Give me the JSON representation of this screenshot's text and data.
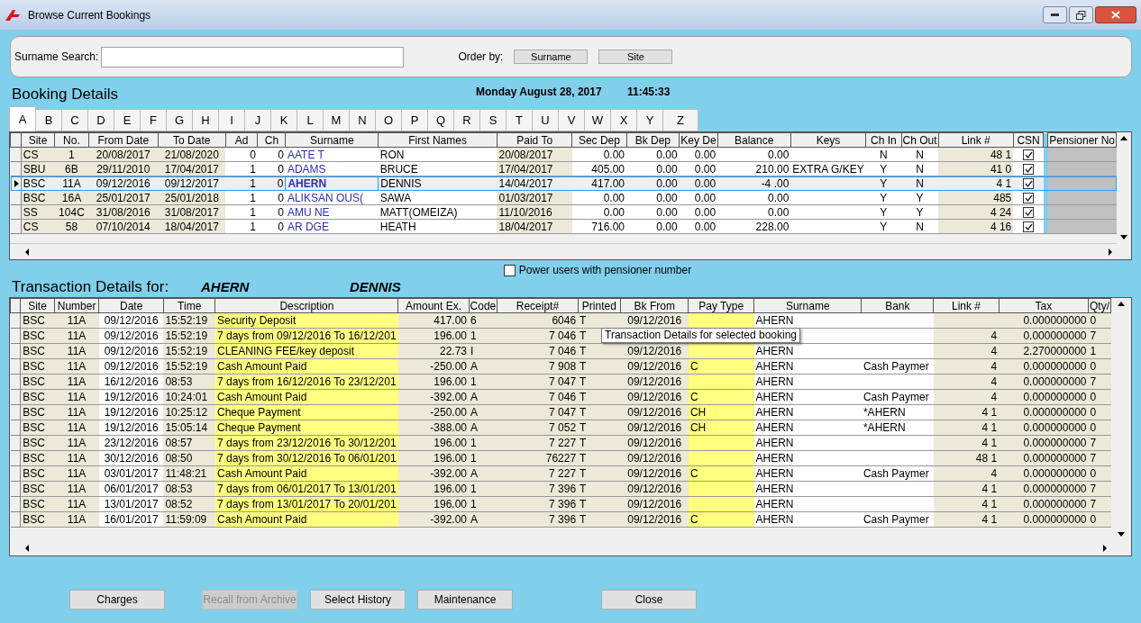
{
  "window": {
    "title": "Browse Current Bookings"
  },
  "search": {
    "label": "Surname Search:"
  },
  "order_by": {
    "label": "Order by:",
    "buttons": [
      "Surname",
      "Site"
    ]
  },
  "booking_heading": "Booking Details",
  "date": "Monday August 28, 2017",
  "time": "11:45:33",
  "tabs": [
    {
      "label": "A",
      "selected": true
    },
    {
      "label": "B",
      "selected": false
    },
    {
      "label": "C",
      "selected": false
    },
    {
      "label": "D",
      "selected": false
    },
    {
      "label": "E",
      "selected": false
    },
    {
      "label": "F",
      "selected": false
    },
    {
      "label": "G",
      "selected": false
    },
    {
      "label": "H",
      "selected": false
    },
    {
      "label": "I",
      "selected": false
    },
    {
      "label": "J",
      "selected": false
    },
    {
      "label": "K",
      "selected": false
    },
    {
      "label": "L",
      "selected": false
    },
    {
      "label": "M",
      "selected": false
    },
    {
      "label": "N",
      "selected": false
    },
    {
      "label": "O",
      "selected": false
    },
    {
      "label": "P",
      "selected": false
    },
    {
      "label": "Q",
      "selected": false
    },
    {
      "label": "R",
      "selected": false
    },
    {
      "label": "S",
      "selected": false
    },
    {
      "label": "T",
      "selected": false
    },
    {
      "label": "U",
      "selected": false
    },
    {
      "label": "V",
      "selected": false
    },
    {
      "label": "W",
      "selected": false
    },
    {
      "label": "X",
      "selected": false
    },
    {
      "label": "Y",
      "selected": false
    },
    {
      "label": "Z",
      "selected": false
    }
  ],
  "bookings": {
    "columns": [
      "Site",
      "No.",
      "From Date",
      "To Date",
      "Ad",
      "Ch",
      "Surname",
      "First Names",
      "Paid To",
      "Sec Dep",
      "Bk Dep",
      "Key De",
      "Balance",
      "Keys",
      "Ch In",
      "Ch Out",
      "Link #",
      "CSN",
      "Pensioner No"
    ],
    "rows": [
      {
        "selected": false,
        "csn": true,
        "cells": [
          "CS",
          "1",
          "20/08/2017",
          "21/08/2020",
          "0",
          "0",
          "AATE T",
          "RON",
          "20/08/2017",
          "0.00",
          "0.00",
          "0.00",
          "0.00",
          null,
          "N",
          "N",
          "48 1"
        ]
      },
      {
        "selected": false,
        "csn": true,
        "cells": [
          "SBU",
          "6B",
          "29/11/2010",
          "17/04/2017",
          "1",
          "0",
          "ADAMS",
          "BRUCE",
          "17/04/2017",
          "405.00",
          "0.00",
          "0.00",
          "210.00",
          "EXTRA G/KEY",
          "Y",
          "N",
          "41 0"
        ]
      },
      {
        "selected": true,
        "csn": true,
        "cells": [
          "BSC",
          "11A",
          "09/12/2016",
          "09/12/2017",
          "1",
          "0",
          "AHERN",
          "DENNIS",
          "14/04/2017",
          "417.00",
          "0.00",
          "0.00",
          "-4 .00",
          null,
          "Y",
          "N",
          "4 1"
        ]
      },
      {
        "selected": false,
        "csn": true,
        "cells": [
          "BSC",
          "16A",
          "25/01/2017",
          "25/01/2018",
          "1",
          "0",
          "ALIKSAN OUS(",
          "SAWA",
          "01/03/2017",
          "0.00",
          "0.00",
          "0.00",
          "0.00",
          null,
          "Y",
          "Y",
          "485"
        ]
      },
      {
        "selected": false,
        "csn": true,
        "cells": [
          "SS",
          "104C",
          "31/08/2016",
          "31/08/2017",
          "1",
          "0",
          "AMU NE",
          "MATT(OMEIZA)",
          "11/10/2016",
          "0.00",
          "0.00",
          "0.00",
          "0.00",
          null,
          "Y",
          "Y",
          "4 24"
        ]
      },
      {
        "selected": false,
        "csn": true,
        "cells": [
          "CS",
          "58",
          "07/10/2014",
          "18/04/2017",
          "1",
          "0",
          "AR DGE",
          "HEATH",
          "18/04/2017",
          "716.00",
          "0.00",
          "0.00",
          "228.00",
          null,
          "Y",
          "N",
          "4 16"
        ]
      }
    ]
  },
  "power_users": {
    "label": "Power users with pensioner number",
    "checked": false
  },
  "transactions_heading": {
    "label": "Transaction Details for:",
    "surname": "AHERN",
    "first_names": "DENNIS"
  },
  "transactions": {
    "columns": [
      "Site",
      "Number",
      "Date",
      "Time",
      "Description",
      "Amount Ex.",
      "Code",
      "Receipt#",
      "Printed",
      "Bk From",
      "Pay Type",
      "Surname",
      "Bank",
      "Link #",
      "Tax",
      "Qty/"
    ],
    "rows": [
      [
        "BSC",
        "11A",
        "09/12/2016",
        "15:52:19",
        "Security Deposit",
        "417.00",
        "6",
        "6046",
        "T",
        "09/12/2016",
        null,
        "AHERN",
        null,
        null,
        "0.000000000",
        "0"
      ],
      [
        "BSC",
        "11A",
        "09/12/2016",
        "15:52:19",
        "7 days from 09/12/2016 To 16/12/201",
        "196.00",
        "1",
        "7 046",
        "T",
        null,
        null,
        null,
        null,
        "4",
        "0.000000000",
        "7"
      ],
      [
        "BSC",
        "11A",
        "09/12/2016",
        "15:52:19",
        "CLEANING FEE/key deposit",
        "22.73",
        "I",
        "7 046",
        "T",
        "09/12/2016",
        null,
        "AHERN",
        null,
        "4",
        "2.270000000",
        "1"
      ],
      [
        "BSC",
        "11A",
        "09/12/2016",
        "15:52:19",
        "Cash Amount Paid",
        "-250.00",
        "A",
        "7 908",
        "T",
        "09/12/2016",
        "C",
        "AHERN",
        "Cash Paymer",
        "4",
        "0.000000000",
        "0"
      ],
      [
        "BSC",
        "11A",
        "16/12/2016",
        "08:53",
        "7 days from 16/12/2016 To 23/12/201",
        "196.00",
        "1",
        "7 047",
        "T",
        "09/12/2016",
        null,
        "AHERN",
        null,
        "4",
        "0.000000000",
        "7"
      ],
      [
        "BSC",
        "11A",
        "19/12/2016",
        "10:24:01",
        "Cash Amount Paid",
        "-392.00",
        "A",
        "7 046",
        "T",
        "09/12/2016",
        "C",
        "AHERN",
        "Cash Paymer",
        "4",
        "0.000000000",
        "0"
      ],
      [
        "BSC",
        "11A",
        "19/12/2016",
        "10:25:12",
        "Cheque Payment",
        "-250.00",
        "A",
        "7 047",
        "T",
        "09/12/2016",
        "CH",
        "AHERN",
        "*AHERN",
        "4 1",
        "0.000000000",
        "0"
      ],
      [
        "BSC",
        "11A",
        "19/12/2016",
        "15:05:14",
        "Cheque Payment",
        "-388.00",
        "A",
        "7 052",
        "T",
        "09/12/2016",
        "CH",
        "AHERN",
        "*AHERN",
        "4 1",
        "0.000000000",
        "0"
      ],
      [
        "BSC",
        "11A",
        "23/12/2016",
        "08:57",
        "7 days from 23/12/2016 To 30/12/201",
        "196.00",
        "1",
        "7 227",
        "T",
        "09/12/2016",
        null,
        "AHERN",
        null,
        "4 1",
        "0.000000000",
        "7"
      ],
      [
        "BSC",
        "11A",
        "30/12/2016",
        "08:50",
        "7 days from 30/12/2016 To 06/01/201",
        "196.00",
        "1",
        "76227",
        "T",
        "09/12/2016",
        null,
        "AHERN",
        null,
        "48 1",
        "0.000000000",
        "7"
      ],
      [
        "BSC",
        "11A",
        "03/01/2017",
        "11:48:21",
        "Cash Amount Paid",
        "-392.00",
        "A",
        "7 227",
        "T",
        "09/12/2016",
        "C",
        "AHERN",
        "Cash Paymer",
        "4",
        "0.000000000",
        "0"
      ],
      [
        "BSC",
        "11A",
        "06/01/2017",
        "08:53",
        "7 days from 06/01/2017 To 13/01/201",
        "196.00",
        "1",
        "7 396",
        "T",
        "09/12/2016",
        null,
        "AHERN",
        null,
        "4 1",
        "0.000000000",
        "7"
      ],
      [
        "BSC",
        "11A",
        "13/01/2017",
        "08:52",
        "7 days from 13/01/2017 To 20/01/201",
        "196.00",
        "1",
        "7 396",
        "T",
        "09/12/2016",
        null,
        "AHERN",
        null,
        "4 1",
        "0.000000000",
        "7"
      ],
      [
        "BSC",
        "11A",
        "16/01/2017",
        "11:59:09",
        "Cash Amount Paid",
        "-392.00",
        "A",
        "7 396",
        "T",
        "09/12/2016",
        "C",
        "AHERN",
        "Cash Paymer",
        "4 1",
        "0.000000000",
        "0"
      ]
    ]
  },
  "tooltip": "Transaction Details for selected booking",
  "buttons": [
    {
      "label": "Charges",
      "disabled": false
    },
    {
      "label": "Recall from Archive",
      "disabled": true
    },
    {
      "label": "Select History",
      "disabled": false
    },
    {
      "label": "Maintenance",
      "disabled": false
    },
    {
      "label": "Close",
      "disabled": false
    }
  ]
}
